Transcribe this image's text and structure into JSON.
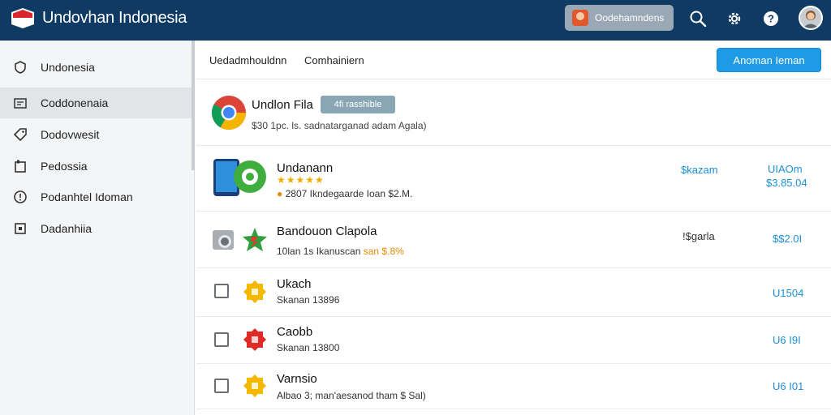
{
  "app": {
    "title": "Undovhan Indonesia",
    "account_pill": "Oodehamndens"
  },
  "topbar_icons": [
    "search-icon",
    "gear-icon",
    "help-icon",
    "user-avatar"
  ],
  "sidebar": {
    "items": [
      {
        "label": "Undonesia",
        "icon": "shield-icon"
      },
      {
        "label": "Coddonenaia",
        "icon": "image-icon",
        "active": true
      },
      {
        "label": "Dodovwesit",
        "icon": "tag-icon"
      },
      {
        "label": "Pedossia",
        "icon": "document-icon"
      },
      {
        "label": "Podanhtel Idoman",
        "icon": "info-icon"
      },
      {
        "label": "Dadanhiia",
        "icon": "square-icon"
      }
    ]
  },
  "header": {
    "breadcrumb": [
      "Uedadmhouldnn",
      "Comhainiern"
    ],
    "primary_action": "Anoman Ieman"
  },
  "featured": {
    "title": "Undlon Fila",
    "badge": "4fi rasshible",
    "description": "$30 1pc. ls. sadnatarganad adam Agala)"
  },
  "rows": [
    {
      "title": "Undanann",
      "stars": "★★★★★",
      "sub": "2807 Ikndegaarde Ioan $2.M.",
      "status": "$kazam",
      "price_top": "UIAOm",
      "price": "$3.85.04",
      "icon": "phone-app-icon"
    },
    {
      "title": "Bandouon Clapola",
      "sub": "10lan 1s Ikanuscan",
      "sub_highlight": "san $.8%",
      "status": "!$garla",
      "price": "$$2.0I",
      "icon": "green-star-icon",
      "checkbox": "filled"
    },
    {
      "title": "Ukach",
      "sub": "Skanan 13896",
      "price": "U1504",
      "icon": "yellow-badge-icon",
      "checkbox": "empty"
    },
    {
      "title": "Caobb",
      "sub": "Skanan 13800",
      "price": "U6 I9I",
      "icon": "red-badge-icon",
      "checkbox": "empty"
    },
    {
      "title": "Varnsio",
      "sub": "Albao 3; man'aesanod tham $ Sal)",
      "price": "U6 I01",
      "icon": "yellow-badge-icon",
      "checkbox": "empty"
    }
  ],
  "colors": {
    "topbar": "#0f3a63",
    "accent": "#1f9be6",
    "price": "#1a8fd8"
  }
}
